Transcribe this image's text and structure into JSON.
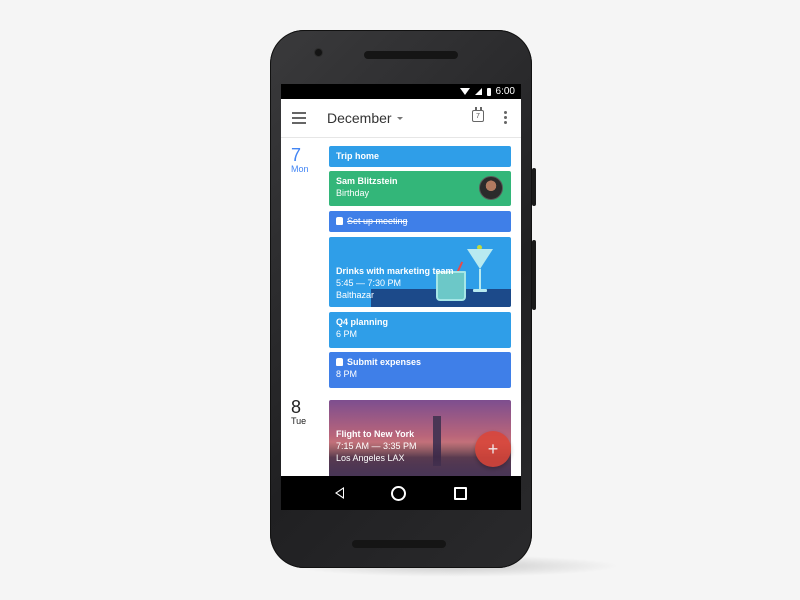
{
  "status_bar": {
    "time": "6:00",
    "icons": [
      "wifi-icon",
      "signal-icon",
      "battery-icon"
    ]
  },
  "app_bar": {
    "title": "December",
    "today_icon_day": "7"
  },
  "days": [
    {
      "number": "7",
      "name": "Mon",
      "events": [
        {
          "title": "Trip home",
          "color": "#2f9ee8"
        },
        {
          "title": "Sam Blitzstein",
          "subtitle": "Birthday",
          "color": "#33b679"
        },
        {
          "title": "Set up meeting",
          "type": "task",
          "done": true,
          "color": "#3f7fe8"
        },
        {
          "title": "Drinks with marketing team",
          "time": "5:45 — 7:30 PM",
          "location": "Balthazar",
          "color": "#2f9ee8"
        },
        {
          "title": "Q4 planning",
          "time": "6 PM",
          "color": "#2f9ee8"
        },
        {
          "title": "Submit expenses",
          "time": "8 PM",
          "type": "task",
          "color": "#3f7fe8"
        }
      ]
    },
    {
      "number": "8",
      "name": "Tue",
      "events": [
        {
          "title": "Flight to New York",
          "time": "7:15 AM — 3:35 PM",
          "location": "Los Angeles LAX"
        }
      ]
    }
  ],
  "fab": {
    "label": "+"
  },
  "colors": {
    "today": "#4285f4",
    "fab": "#db4437"
  }
}
